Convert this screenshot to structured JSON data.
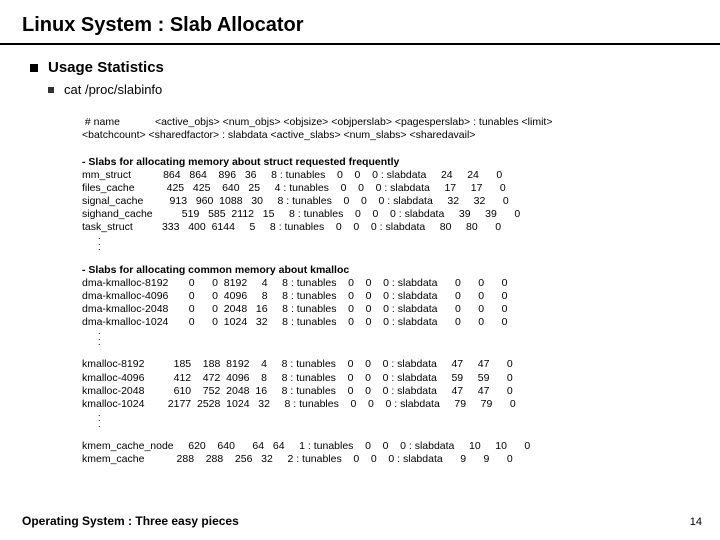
{
  "title": "Linux System : Slab Allocator",
  "section": "Usage Statistics",
  "command": "cat /proc/slabinfo",
  "header1": " # name            <active_objs> <num_objs> <objsize> <objperslab> <pagesperslab> : tunables <limit>",
  "header2": "<batchcount> <sharedfactor> : slabdata <active_slabs> <num_slabs> <sharedavail>",
  "group1_title": "- Slabs for allocating memory about struct requested frequently",
  "group1_rows": [
    "mm_struct           864   864    896   36     8 : tunables    0    0    0 : slabdata     24     24      0",
    "files_cache           425   425    640   25     4 : tunables    0    0    0 : slabdata     17     17      0",
    "signal_cache         913   960  1088   30     8 : tunables    0    0    0 : slabdata     32     32      0",
    "sighand_cache          519   585  2112   15     8 : tunables    0    0    0 : slabdata     39     39      0",
    "task_struct          333   400  6144     5     8 : tunables    0    0    0 : slabdata     80     80      0"
  ],
  "group2_title": "- Slabs for allocating common memory about kmalloc",
  "group2_rows": [
    "dma-kmalloc-8192       0      0  8192     4     8 : tunables    0    0    0 : slabdata      0      0      0",
    "dma-kmalloc-4096       0      0  4096     8     8 : tunables    0    0    0 : slabdata      0      0      0",
    "dma-kmalloc-2048       0      0  2048   16     8 : tunables    0    0    0 : slabdata      0      0      0",
    "dma-kmalloc-1024       0      0  1024   32     8 : tunables    0    0    0 : slabdata      0      0      0"
  ],
  "group3_rows": [
    "kmalloc-8192          185    188  8192    4     8 : tunables    0    0    0 : slabdata     47     47      0",
    "kmalloc-4096          412    472  4096    8     8 : tunables    0    0    0 : slabdata     59     59      0",
    "kmalloc-2048          610    752  2048  16     8 : tunables    0    0    0 : slabdata     47     47      0",
    "kmalloc-1024        2177  2528  1024   32     8 : tunables    0    0    0 : slabdata     79     79      0"
  ],
  "group4_rows": [
    "kmem_cache_node     620    640      64   64     1 : tunables    0    0    0 : slabdata     10     10      0",
    "kmem_cache           288    288    256   32     2 : tunables    0    0    0 : slabdata      9      9      0"
  ],
  "footer": "Operating System : Three easy pieces",
  "pagenum": "14"
}
